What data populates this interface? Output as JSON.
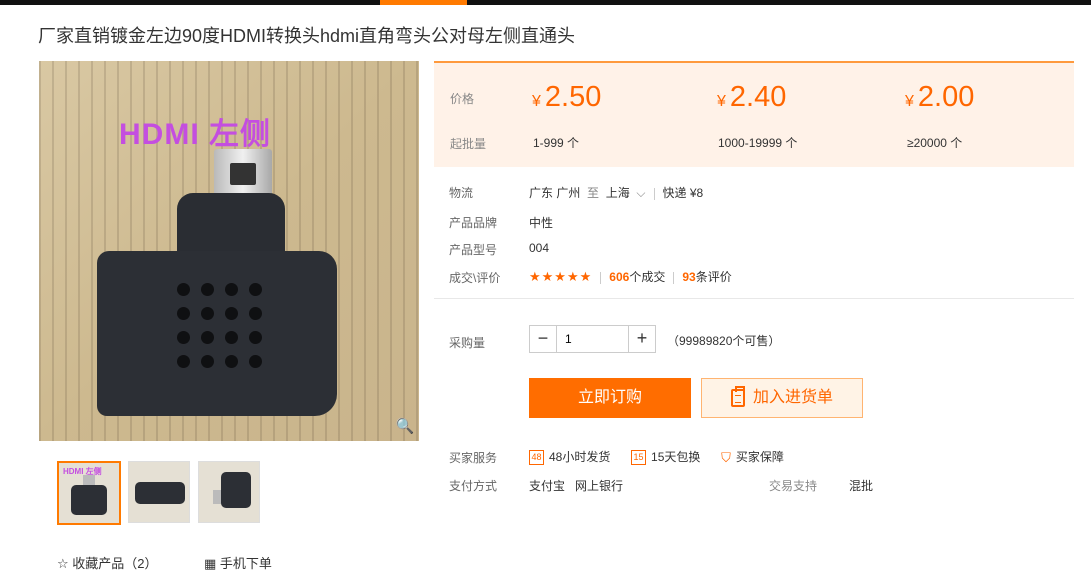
{
  "product": {
    "title": "厂家直销镀金左边90度HDMI转换头hdmi直角弯头公对母左侧直通头",
    "image_label": "HDMI  左侧",
    "thumb_label": "HDMI 左侧"
  },
  "price": {
    "price_label": "价格",
    "min_label": "起批量",
    "currency": "¥",
    "tiers": [
      {
        "price": "2.50",
        "range": "1-999 个"
      },
      {
        "price": "2.40",
        "range": "1000-19999 个"
      },
      {
        "price": "2.00",
        "range": "≥20000 个"
      }
    ]
  },
  "info": {
    "logistics_label": "物流",
    "from": "广东 广州",
    "to_word": "至",
    "to": "上海",
    "express": "快递 ¥8",
    "brand_label": "产品品牌",
    "brand": "中性",
    "model_label": "产品型号",
    "model": "004",
    "deals_label": "成交\\评价",
    "stars": "★★★★★",
    "deals_count": "606",
    "deals_suffix": "个成交",
    "reviews_count": "93",
    "reviews_suffix": "条评价"
  },
  "purchase": {
    "qty_label": "采购量",
    "qty_value": "1",
    "stock": "（99989820个可售）",
    "buy_label": "立即订购",
    "cart_label": "加入进货单"
  },
  "services": {
    "label": "买家服务",
    "items": [
      "48小时发货",
      "15天包换",
      "买家保障"
    ],
    "icons": [
      "48",
      "15"
    ]
  },
  "payment": {
    "label": "支付方式",
    "methods": [
      "支付宝",
      "网上银行"
    ],
    "trade_label": "交易支持",
    "trade_value": "混批"
  },
  "footer": {
    "favorite": "收藏产品（2）",
    "mobile_order": "手机下单"
  },
  "colors": {
    "accent": "#ff6d00",
    "price": "#ff6600",
    "panel_bg": "#fff2e8"
  }
}
